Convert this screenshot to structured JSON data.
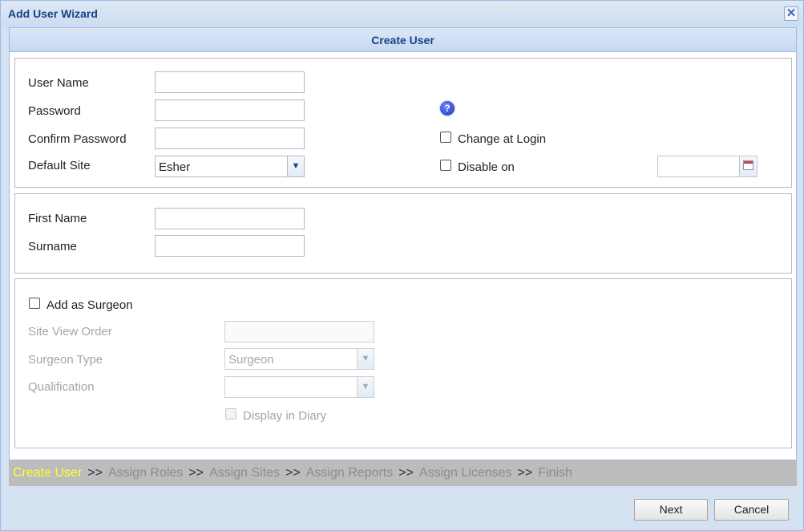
{
  "window": {
    "title": "Add User Wizard",
    "close_icon": "close-icon"
  },
  "panel": {
    "header": "Create User"
  },
  "user": {
    "username_label": "User Name",
    "username_value": "",
    "password_label": "Password",
    "password_value": "",
    "confirm_label": "Confirm Password",
    "confirm_value": "",
    "site_label": "Default Site",
    "site_value": "Esher",
    "change_login_label": "Change at Login",
    "change_login_checked": false,
    "disable_on_label": "Disable on",
    "disable_on_checked": false,
    "disable_on_date": ""
  },
  "name": {
    "first_label": "First Name",
    "first_value": "",
    "surname_label": "Surname",
    "surname_value": ""
  },
  "surgeon": {
    "add_label": "Add as Surgeon",
    "add_checked": false,
    "view_order_label": "Site View Order",
    "view_order_value": "",
    "type_label": "Surgeon Type",
    "type_value": "Surgeon",
    "qualification_label": "Qualification",
    "qualification_value": "",
    "diary_label": "Display in Diary",
    "diary_checked": false
  },
  "steps": [
    {
      "label": "Create User",
      "active": true
    },
    {
      "label": "Assign Roles",
      "active": false
    },
    {
      "label": "Assign Sites",
      "active": false
    },
    {
      "label": "Assign Reports",
      "active": false
    },
    {
      "label": "Assign Licenses",
      "active": false
    },
    {
      "label": "Finish",
      "active": false
    }
  ],
  "step_separator": ">>",
  "buttons": {
    "next": "Next",
    "cancel": "Cancel"
  },
  "colors": {
    "title": "#15428b",
    "active_step": "#ffff33",
    "inactive_step": "#8c8c8c",
    "help_icon": "#1d2fb8"
  }
}
